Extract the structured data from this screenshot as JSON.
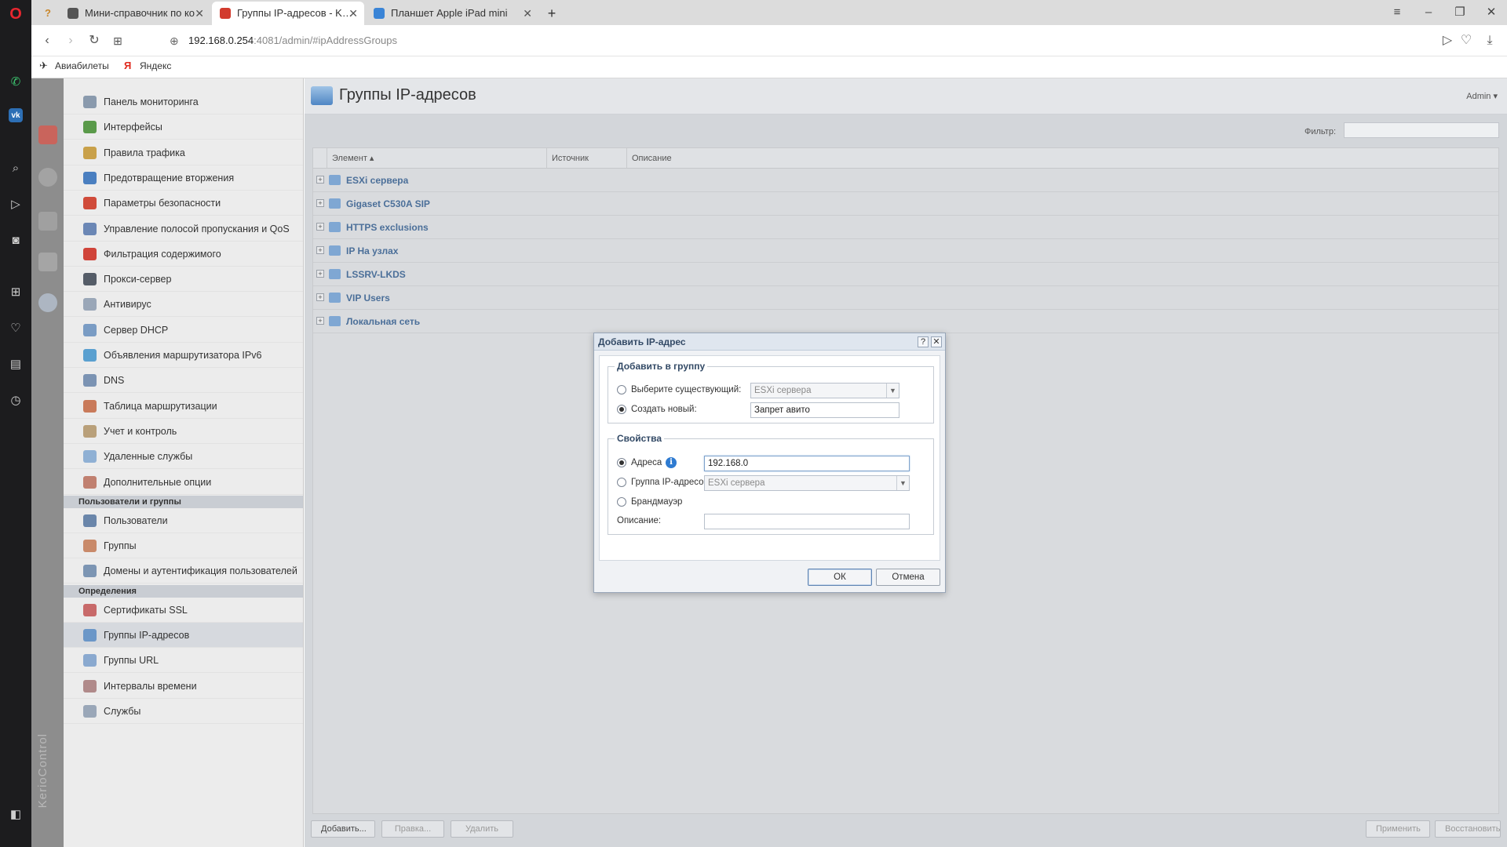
{
  "browser": {
    "tabs": [
      {
        "label": "Мини-справочник по ко",
        "active": false
      },
      {
        "label": "Группы IP-адресов - Kerio",
        "active": true
      },
      {
        "label": "Планшет Apple iPad mini",
        "active": false
      }
    ],
    "url_host": "192.168.0.254",
    "url_rest": ":4081/admin/#ipAddressGroups",
    "bookmarks": [
      "Авиабилеты",
      "Яндекс"
    ],
    "icons": {
      "back": "back-arrow-icon",
      "forward": "forward-arrow-icon",
      "reload": "reload-icon",
      "speed_dial": "grid-icon",
      "site_info": "globe-icon",
      "send": "send-icon",
      "bookmark": "heart-icon",
      "download": "download-icon"
    }
  },
  "app": {
    "brand": "KerioControl",
    "page_title": "Группы IP-адресов",
    "user_menu": "Admin ▾",
    "filter_label": "Фильтр:"
  },
  "sidebar": {
    "items": [
      {
        "label": "Панель мониторинга",
        "icon": "dashboard-icon",
        "color": "#8a9aad"
      },
      {
        "label": "Интерфейсы",
        "icon": "interfaces-icon",
        "color": "#5a9a4a"
      },
      {
        "label": "Правила трафика",
        "icon": "traffic-rules-icon",
        "color": "#c9a14a"
      },
      {
        "label": "Предотвращение вторжения",
        "icon": "shield-icon",
        "color": "#4a7fc0"
      },
      {
        "label": "Параметры безопасности",
        "icon": "security-icon",
        "color": "#d04b3a"
      },
      {
        "label": "Управление полосой пропускания и QoS",
        "icon": "bandwidth-icon",
        "color": "#6b87b5"
      },
      {
        "label": "Фильтрация содержимого",
        "icon": "filter-icon",
        "color": "#d0443a"
      },
      {
        "label": "Прокси-сервер",
        "icon": "proxy-icon",
        "color": "#555d68"
      },
      {
        "label": "Антивирус",
        "icon": "antivirus-icon",
        "color": "#9aa7b8"
      },
      {
        "label": "Сервер DHCP",
        "icon": "dhcp-icon",
        "color": "#7a9cc4"
      },
      {
        "label": "Объявления маршрутизатора IPv6",
        "icon": "ipv6-icon",
        "color": "#5aa0d0"
      },
      {
        "label": "DNS",
        "icon": "dns-icon",
        "color": "#7b93b3"
      },
      {
        "label": "Таблица маршрутизации",
        "icon": "routing-icon",
        "color": "#c97a5a"
      },
      {
        "label": "Учет и контроль",
        "icon": "accounting-icon",
        "color": "#b9a07a"
      },
      {
        "label": "Удаленные службы",
        "icon": "cloud-icon",
        "color": "#8fb0d4"
      },
      {
        "label": "Дополнительные опции",
        "icon": "options-icon",
        "color": "#c08070"
      }
    ],
    "section_users": "Пользователи и группы",
    "user_items": [
      {
        "label": "Пользователи",
        "icon": "user-icon",
        "color": "#6a86aa"
      },
      {
        "label": "Группы",
        "icon": "group-icon",
        "color": "#c98a6a"
      },
      {
        "label": "Домены и аутентификация пользователей",
        "icon": "domain-icon",
        "color": "#7c95b3"
      }
    ],
    "section_definitions": "Определения",
    "definition_items": [
      {
        "label": "Сертификаты SSL",
        "icon": "certificate-icon",
        "color": "#c86a6a"
      },
      {
        "label": "Группы IP-адресов",
        "icon": "ip-group-icon",
        "color": "#6b97c8",
        "selected": true
      },
      {
        "label": "Группы URL",
        "icon": "url-group-icon",
        "color": "#8aa9cf"
      },
      {
        "label": "Интервалы времени",
        "icon": "clock-icon",
        "color": "#b08a8a"
      },
      {
        "label": "Службы",
        "icon": "services-icon",
        "color": "#9aa7b8"
      }
    ]
  },
  "grid": {
    "columns": [
      "Элемент ▴",
      "Источник",
      "Описание"
    ],
    "rows": [
      "ESXi сервера",
      "Gigaset C530A SIP",
      "HTTPS exclusions",
      "IP На узлах",
      "LSSRV-LKDS",
      "VIP Users",
      "Локальная сеть"
    ]
  },
  "toolbar": {
    "add": "Добавить...",
    "edit": "Правка...",
    "delete": "Удалить",
    "apply": "Применить",
    "restore": "Восстановить"
  },
  "dialog": {
    "title": "Добавить IP-адрес",
    "group_legend": "Добавить в группу",
    "select_existing_label": "Выберите существующий:",
    "select_existing_value": "ESXi сервера",
    "create_new_label": "Создать новый:",
    "create_new_value": "Запрет авито",
    "props_legend": "Свойства",
    "address_label": "Адреса",
    "address_value": "192.168.0",
    "ipgroup_label": "Группа IP-адресов",
    "ipgroup_value": "ESXi сервера",
    "firewall_label": "Брандмауэр",
    "description_label": "Описание:",
    "description_value": "",
    "ok": "ОК",
    "cancel": "Отмена",
    "help": "?",
    "close": "✕"
  }
}
